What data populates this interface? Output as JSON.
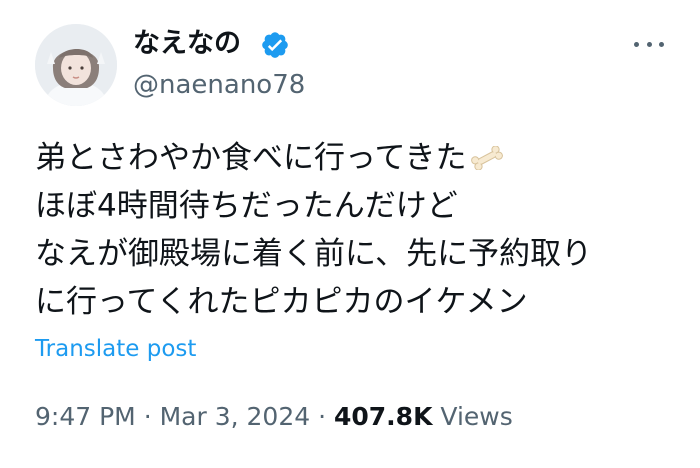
{
  "author": {
    "display_name": "なえなの",
    "handle": "@naenano78",
    "verified": true
  },
  "tweet": {
    "lines": [
      "弟とさわやか食べに行ってきた",
      "ほぼ4時間待ちだったんだけど",
      "なえが御殿場に着く前に、先に予約取り",
      "に行ってくれたピカピカのイケメン"
    ],
    "emoji_after_line_1": "bone-emoji"
  },
  "actions": {
    "translate_label": "Translate post"
  },
  "meta": {
    "time": "9:47 PM",
    "separator": "·",
    "date": "Mar 3, 2024",
    "views_count": "407.8K",
    "views_label": "Views"
  },
  "colors": {
    "text_primary": "#0f1419",
    "text_secondary": "#536471",
    "accent": "#1d9bf0"
  }
}
